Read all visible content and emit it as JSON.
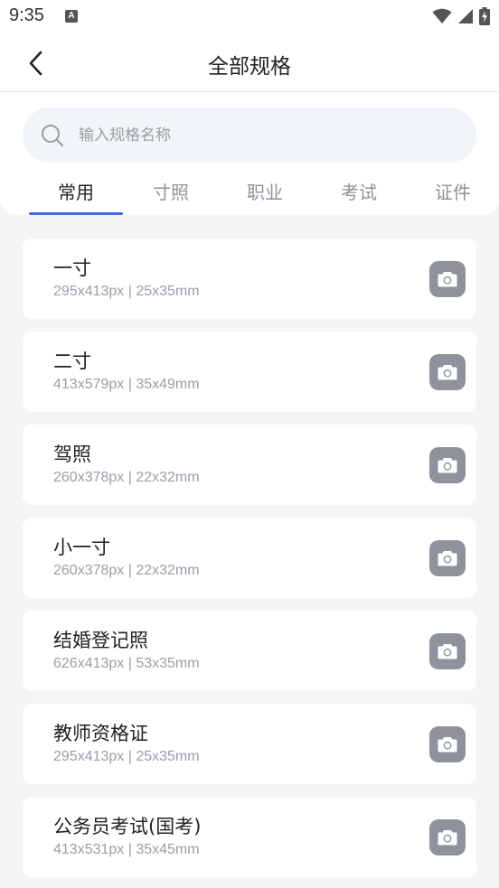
{
  "status_bar": {
    "time": "9:35",
    "notification_letter": "A",
    "icons": [
      "wifi-icon",
      "signal-icon",
      "battery-charging-icon"
    ]
  },
  "header": {
    "back_icon": "chevron-left-icon",
    "title": "全部规格"
  },
  "search": {
    "icon": "search-icon",
    "placeholder": "输入规格名称",
    "value": ""
  },
  "tabs": [
    {
      "label": "常用",
      "active": true
    },
    {
      "label": "寸照",
      "active": false
    },
    {
      "label": "职业",
      "active": false
    },
    {
      "label": "考试",
      "active": false
    },
    {
      "label": "证件",
      "active": false
    }
  ],
  "colors": {
    "accent": "#3f6ce0",
    "background": "#f4f5f7",
    "camera_button": "#8e939b"
  },
  "specs": [
    {
      "name": "一寸",
      "size": "295x413px | 25x35mm",
      "icon": "camera-icon"
    },
    {
      "name": "二寸",
      "size": "413x579px | 35x49mm",
      "icon": "camera-icon"
    },
    {
      "name": "驾照",
      "size": "260x378px | 22x32mm",
      "icon": "camera-icon"
    },
    {
      "name": "小一寸",
      "size": "260x378px | 22x32mm",
      "icon": "camera-icon"
    },
    {
      "name": "结婚登记照",
      "size": "626x413px | 53x35mm",
      "icon": "camera-icon"
    },
    {
      "name": "教师资格证",
      "size": "295x413px | 25x35mm",
      "icon": "camera-icon"
    },
    {
      "name": "公务员考试(国考)",
      "size": "413x531px | 35x45mm",
      "icon": "camera-icon"
    }
  ]
}
